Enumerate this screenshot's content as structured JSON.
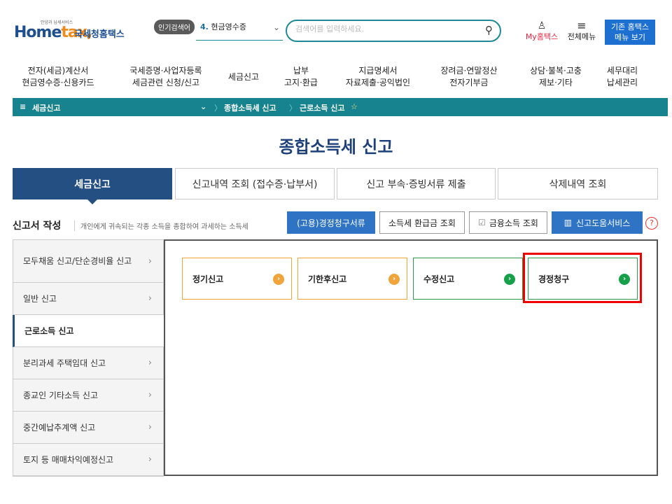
{
  "header": {
    "logo_tagline": "안녕과 납세서비스",
    "logo_home": "Home",
    "logo_tax": "tax,",
    "logo_kor": "국세청홈택스",
    "popular_label": "인기검색어",
    "popular_item_num": "4.",
    "popular_item_text": "현금영수증",
    "search_placeholder": "검색어를 입력하세요.",
    "mytax_label": "My홈택스",
    "allmenu_label": "전체메뉴",
    "old_hometax_line1": "기존 홈택스",
    "old_hometax_line2": "메뉴 보기"
  },
  "gnb": [
    {
      "l1": "전자(세금)계산서",
      "l2": "현금영수증·신용카드"
    },
    {
      "l1": "국세증명·사업자등록",
      "l2": "세금관련 신청/신고"
    },
    {
      "l1": "세금신고",
      "l2": ""
    },
    {
      "l1": "납부",
      "l2": "고지·환급"
    },
    {
      "l1": "지급명세서",
      "l2": "자료제출·공익법인"
    },
    {
      "l1": "장려금·연말정산",
      "l2": "전자기부금"
    },
    {
      "l1": "상담·불복·고충",
      "l2": "제보·기타"
    },
    {
      "l1": "세무대리",
      "l2": "납세관리"
    }
  ],
  "breadcrumb": {
    "root": "세금신고",
    "level2": "종합소득세 신고",
    "level3": "근로소득 신고"
  },
  "page_title": "종합소득세 신고",
  "tabs": [
    "세금신고",
    "신고내역 조회 (접수증·납부서)",
    "신고 부속·증빙서류 제출",
    "삭제내역 조회"
  ],
  "section": {
    "title": "신고서 작성",
    "desc": "개인에게 귀속되는 각종 소득을 종합하여 과세하는 소득세",
    "btn_claim": "(고용)경정청구서류",
    "btn_refund": "소득세 환급금 조회",
    "btn_finance": "금융소득 조회",
    "btn_help": "신고도움서비스"
  },
  "sidebar": [
    "모두채움 신고/단순경비율 신고",
    "일반 신고",
    "근로소득 신고",
    "분리과세 주택임대 신고",
    "종교인 기타소득 신고",
    "중간예납추계액 신고",
    "토지 등 매매차익예정신고"
  ],
  "cards": [
    "정기신고",
    "기한후신고",
    "수정신고",
    "경정청구"
  ],
  "colors": {
    "accent": "#16838e",
    "navy": "#234f83",
    "highlight": "#e00000"
  }
}
